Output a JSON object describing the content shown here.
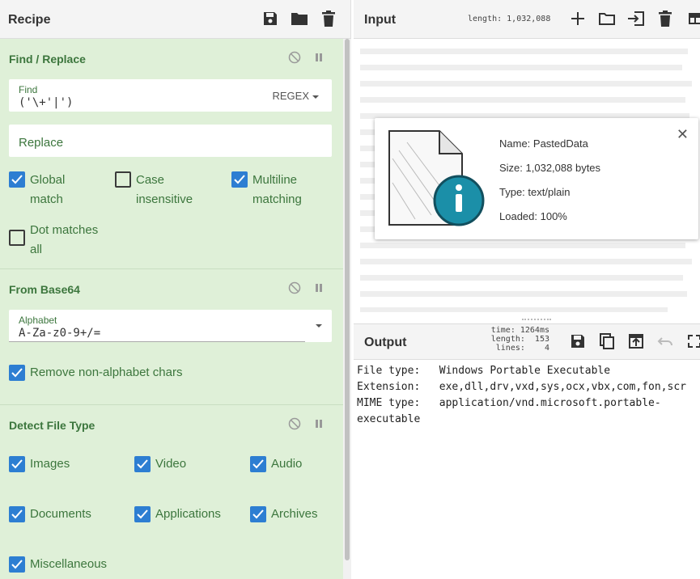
{
  "recipe": {
    "title": "Recipe",
    "header_icons": [
      "save-icon",
      "folder-icon",
      "trash-icon"
    ]
  },
  "ops": {
    "find_replace": {
      "title": "Find / Replace",
      "find_label": "Find",
      "find_value": "('\\+'|')",
      "find_mode": "REGEX",
      "replace_placeholder": "Replace",
      "checkboxes": [
        {
          "label_line1": "Global",
          "label_line2": "match",
          "checked": true
        },
        {
          "label_line1": "Case",
          "label_line2": "insensitive",
          "checked": false
        },
        {
          "label_line1": "Multiline",
          "label_line2": "matching",
          "checked": true
        },
        {
          "label_line1": "Dot matches",
          "label_line2": "all",
          "checked": false
        }
      ]
    },
    "from_base64": {
      "title": "From Base64",
      "alphabet_label": "Alphabet",
      "alphabet_value": "A-Za-z0-9+/=",
      "remove_label": "Remove non-alphabet chars",
      "remove_checked": true
    },
    "detect_file_type": {
      "title": "Detect File Type",
      "checkboxes": [
        {
          "label": "Images",
          "checked": true
        },
        {
          "label": "Video",
          "checked": true
        },
        {
          "label": "Audio",
          "checked": true
        },
        {
          "label": "Documents",
          "checked": true
        },
        {
          "label": "Applications",
          "checked": true
        },
        {
          "label": "Archives",
          "checked": true
        },
        {
          "label": "Miscellaneous",
          "checked": true
        }
      ]
    }
  },
  "input": {
    "title": "Input",
    "length_label": "length: 1,032,088",
    "header_icons": [
      "plus-icon",
      "folder-icon",
      "import-icon",
      "trash-icon",
      "layout-icon"
    ],
    "file": {
      "name": "Name: PastedData",
      "size": "Size: 1,032,088 bytes",
      "type": "Type: text/plain",
      "loaded": "Loaded: 100%"
    }
  },
  "output": {
    "title": "Output",
    "stats": [
      "time: 1264ms",
      "length:  153",
      "lines:    4"
    ],
    "lines": [
      "File type:   Windows Portable Executable",
      "Extension:   exe,dll,drv,vxd,sys,ocx,vbx,com,fon,scr",
      "MIME type:   application/vnd.microsoft.portable-",
      "executable"
    ]
  },
  "colors": {
    "accent": "#2d7ed2",
    "op_bg": "#dff0d8",
    "op_text": "#3c763d"
  }
}
